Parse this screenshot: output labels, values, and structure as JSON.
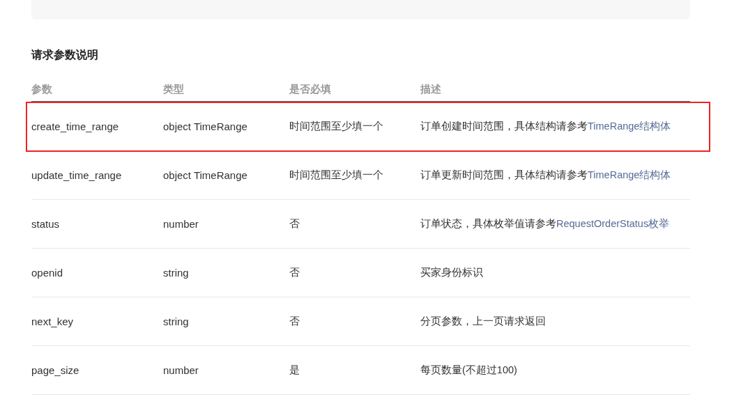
{
  "section_title": "请求参数说明",
  "columns": [
    "参数",
    "类型",
    "是否必填",
    "描述"
  ],
  "rows": [
    {
      "name": "create_time_range",
      "type": "object TimeRange",
      "required": "时间范围至少填一个",
      "description": "订单创建时间范围，具体结构请参考",
      "link": "TimeRange结构体",
      "highlighted": true
    },
    {
      "name": "update_time_range",
      "type": "object TimeRange",
      "required": "时间范围至少填一个",
      "description": "订单更新时间范围，具体结构请参考",
      "link": "TimeRange结构体",
      "highlighted": false
    },
    {
      "name": "status",
      "type": "number",
      "required": "否",
      "description": "订单状态，具体枚举值请参考",
      "link": "RequestOrderStatus枚举",
      "highlighted": false
    },
    {
      "name": "openid",
      "type": "string",
      "required": "否",
      "description": "买家身份标识",
      "highlighted": false
    },
    {
      "name": "next_key",
      "type": "string",
      "required": "否",
      "description": "分页参数，上一页请求返回",
      "highlighted": false
    },
    {
      "name": "page_size",
      "type": "number",
      "required": "是",
      "description": "每页数量(不超过100)",
      "highlighted": false
    }
  ]
}
